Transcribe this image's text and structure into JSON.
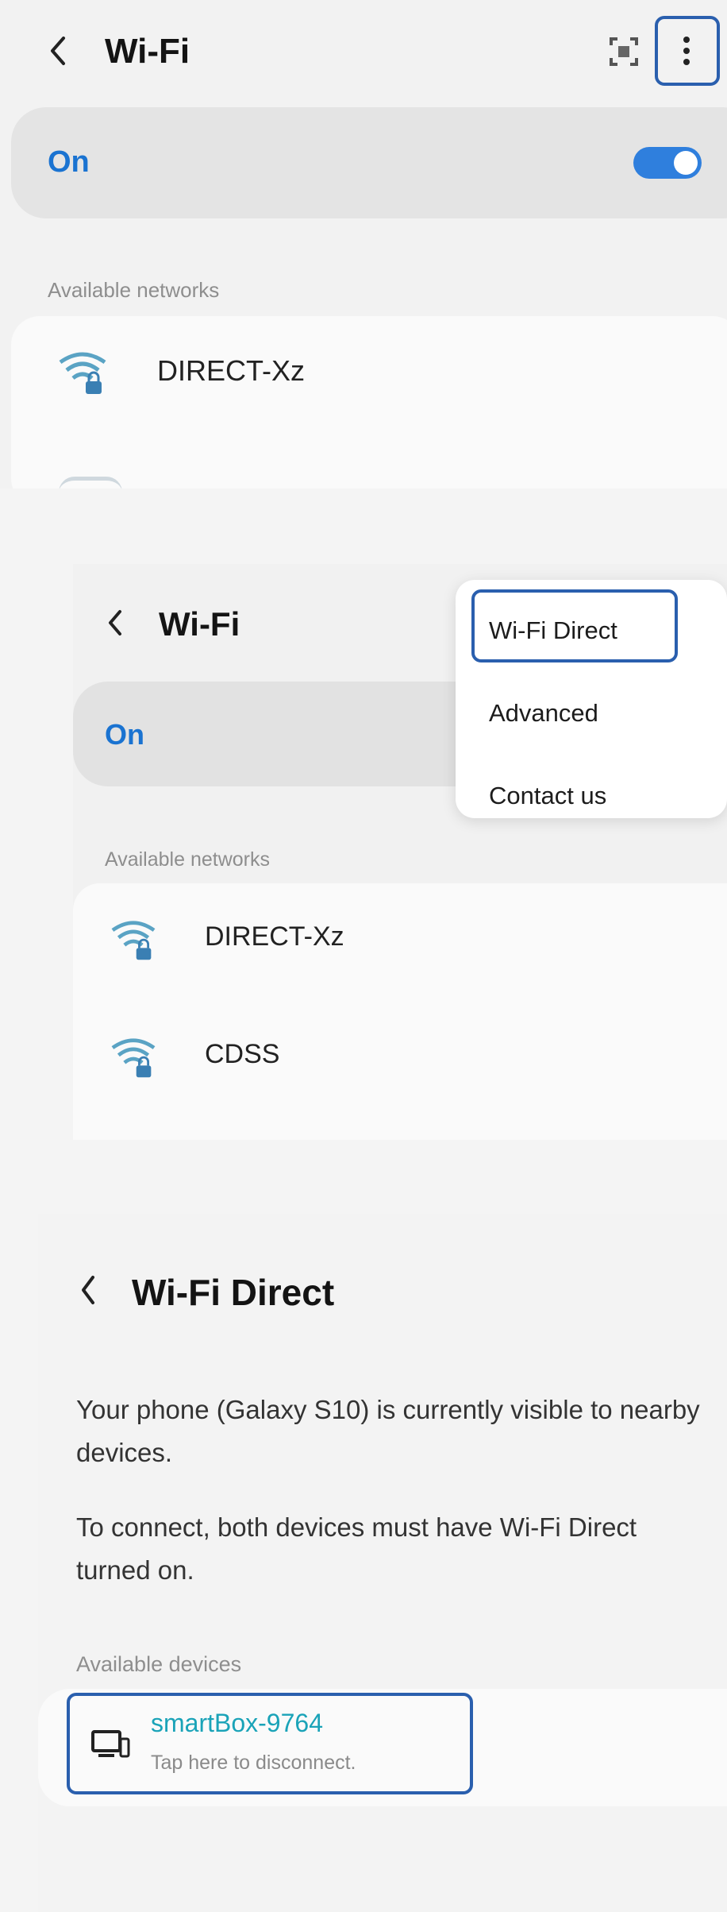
{
  "screen1": {
    "title": "Wi-Fi",
    "toggle_label": "On",
    "toggle_state": true,
    "section_label": "Available networks",
    "networks": [
      {
        "name": "DIRECT-Xz",
        "icon": "wifi-lock-icon"
      }
    ]
  },
  "screen2": {
    "title": "Wi-Fi",
    "toggle_label": "On",
    "section_label": "Available networks",
    "networks": [
      {
        "name": "DIRECT-Xz",
        "icon": "wifi-lock-icon"
      },
      {
        "name": "CDSS",
        "icon": "wifi-lock-icon"
      }
    ],
    "menu": {
      "items": [
        {
          "label": "Wi-Fi Direct",
          "highlighted": true
        },
        {
          "label": "Advanced",
          "highlighted": false
        },
        {
          "label": "Contact us",
          "highlighted": false
        }
      ]
    }
  },
  "screen3": {
    "title": "Wi-Fi Direct",
    "description_1": "Your phone (Galaxy S10) is currently visible to nearby devices.",
    "description_2": "To connect, both devices must have Wi-Fi Direct turned on.",
    "section_label": "Available devices",
    "device": {
      "name": "smartBox-9764",
      "status": "Tap here to disconnect.",
      "icon": "monitor-device-icon"
    }
  },
  "colors": {
    "accent": "#1a73d1",
    "toggle_on": "#2f7fdd",
    "highlight_border": "#2a5fae",
    "device_name": "#1aa3b8"
  }
}
